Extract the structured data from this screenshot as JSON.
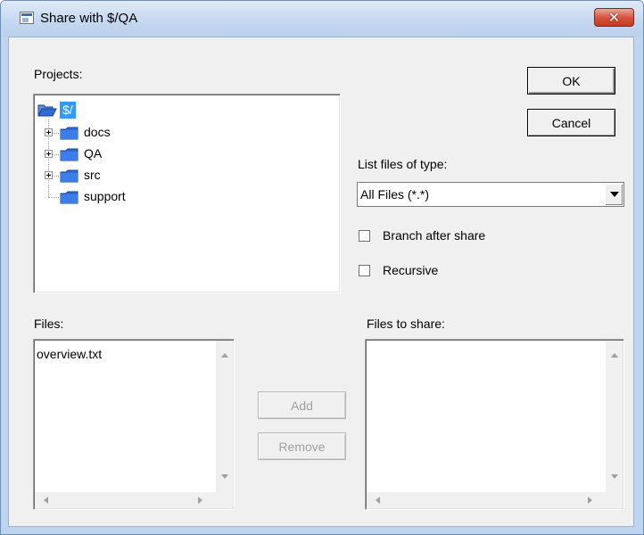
{
  "window": {
    "title": "Share with $/QA",
    "close_symbol": "✕"
  },
  "projects": {
    "label": "Projects:",
    "root": "$/",
    "items": [
      {
        "label": "docs",
        "expandable": true
      },
      {
        "label": "QA",
        "expandable": true
      },
      {
        "label": "src",
        "expandable": true
      },
      {
        "label": "support",
        "expandable": false
      }
    ]
  },
  "buttons": {
    "ok": "OK",
    "cancel": "Cancel",
    "add": "Add",
    "remove": "Remove"
  },
  "filter": {
    "label": "List files of type:",
    "selected": "All Files (*.*)"
  },
  "options": {
    "branch_after_share": {
      "label": "Branch after share",
      "checked": false
    },
    "recursive": {
      "label": "Recursive",
      "checked": false
    }
  },
  "files": {
    "label": "Files:",
    "items": [
      "overview.txt"
    ]
  },
  "files_to_share": {
    "label": "Files to share:",
    "items": []
  },
  "icons": {
    "window": "window-icon",
    "open_folder": "open-folder-icon",
    "folder": "folder-icon",
    "expand": "plus-expander-icon",
    "dropdown": "chevron-down-icon"
  },
  "colors": {
    "selection": "#3399ff",
    "folder_blue": "#2f6ad8",
    "close_red": "#c94a32"
  }
}
